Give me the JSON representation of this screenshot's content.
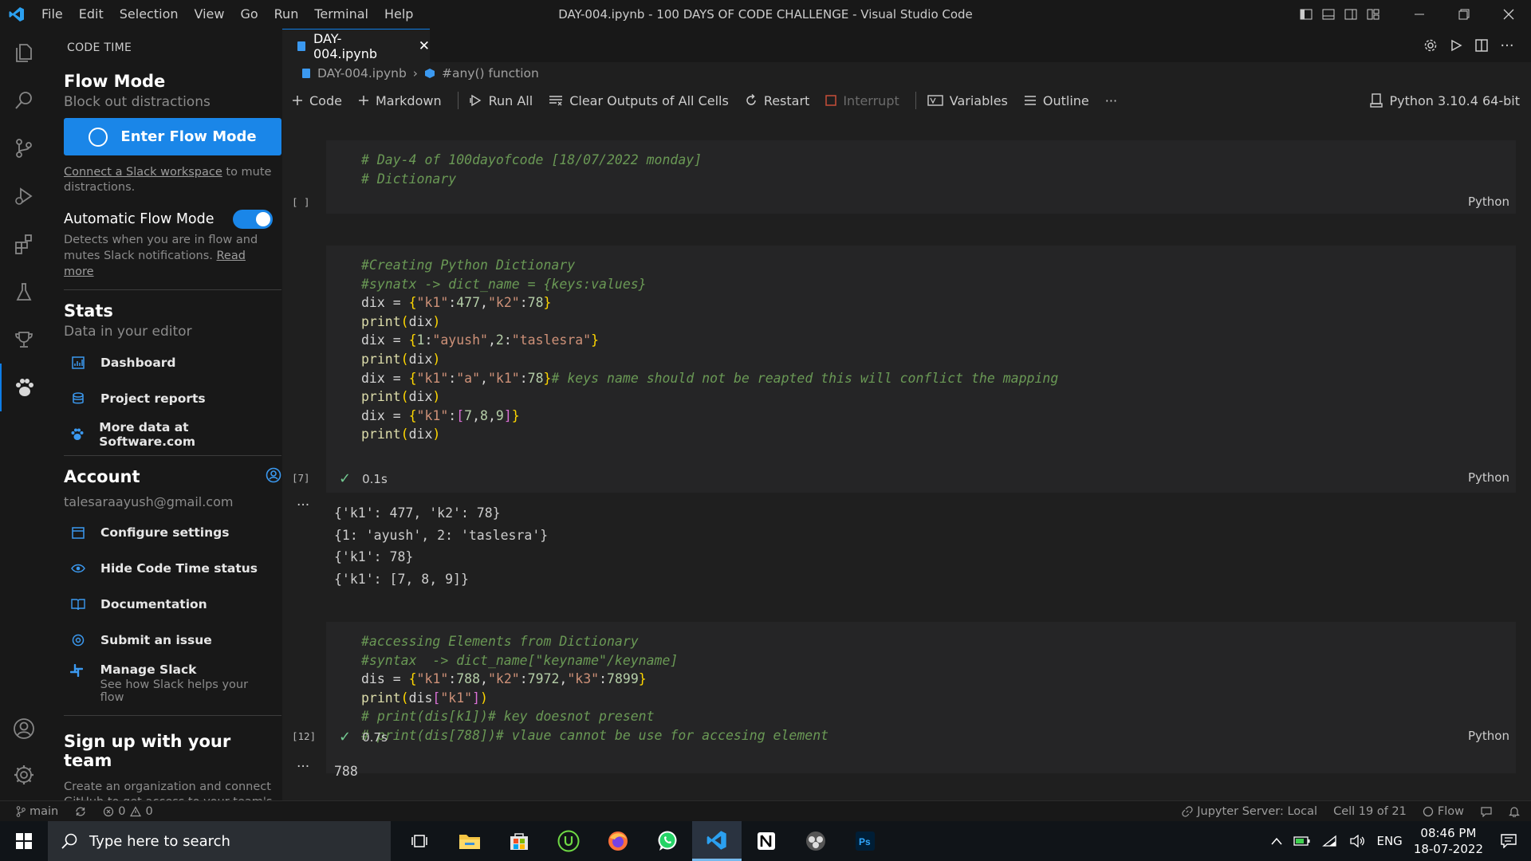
{
  "window": {
    "title": "DAY-004.ipynb - 100 DAYS OF CODE CHALLENGE - Visual Studio Code",
    "menu": [
      "File",
      "Edit",
      "Selection",
      "View",
      "Go",
      "Run",
      "Terminal",
      "Help"
    ]
  },
  "sidebar": {
    "header": "CODE TIME",
    "flow_title": "Flow Mode",
    "flow_sub": "Block out distractions",
    "flow_button": "Enter Flow Mode",
    "slack_link": "Connect a Slack workspace",
    "slack_rest": "to mute distractions.",
    "auto_title": "Automatic Flow Mode",
    "auto_toggle_on": true,
    "auto_desc": "Detects when you are in flow and mutes Slack notifications.",
    "auto_read_more": "Read more",
    "stats_title": "Stats",
    "stats_sub": "Data in your editor",
    "stats_items": [
      "Dashboard",
      "Project reports",
      "More data at Software.com"
    ],
    "account_title": "Account",
    "email": "talesaraayush@gmail.com",
    "account_items": [
      "Configure settings",
      "Hide Code Time status",
      "Documentation",
      "Submit an issue"
    ],
    "slack_item": "Manage Slack",
    "slack_item_sub": "See how Slack helps your flow",
    "team_title": "Sign up with your team",
    "team_desc": "Create an organization and connect GitHub to get access to your team's key DevOps performance metrics,"
  },
  "editor": {
    "tab_label": "DAY-004.ipynb",
    "breadcrumb_file": "DAY-004.ipynb",
    "breadcrumb_symbol": "#any() function",
    "toolbar": {
      "code": "Code",
      "markdown": "Markdown",
      "run_all": "Run All",
      "clear": "Clear Outputs of All Cells",
      "restart": "Restart",
      "interrupt": "Interrupt",
      "variables": "Variables",
      "outline": "Outline",
      "more": "···"
    },
    "kernel": "Python 3.10.4 64-bit",
    "cells": [
      {
        "exec": "[ ]",
        "lang": "Python"
      },
      {
        "exec": "[7]",
        "lang": "Python",
        "time": "0.1s",
        "output": "{'k1': 477, 'k2': 78}\n{1: 'ayush', 2: 'taslesra'}\n{'k1': 78}\n{'k1': [7, 8, 9]}"
      },
      {
        "exec": "[12]",
        "lang": "Python",
        "time": "0.7s",
        "output": "788"
      }
    ],
    "output_dots": "···"
  },
  "statusbar": {
    "branch": "main",
    "errors": "0",
    "warnings": "0",
    "jupyter": "Jupyter Server: Local",
    "cell": "Cell 19 of 21",
    "flow": "Flow"
  },
  "taskbar": {
    "search_placeholder": "Type here to search",
    "lang": "ENG",
    "time": "08:46 PM",
    "date": "18-07-2022"
  },
  "colors": {
    "accent": "#1a86e8",
    "comment": "#6a9955",
    "string": "#ce9178",
    "number": "#b5cea8"
  }
}
